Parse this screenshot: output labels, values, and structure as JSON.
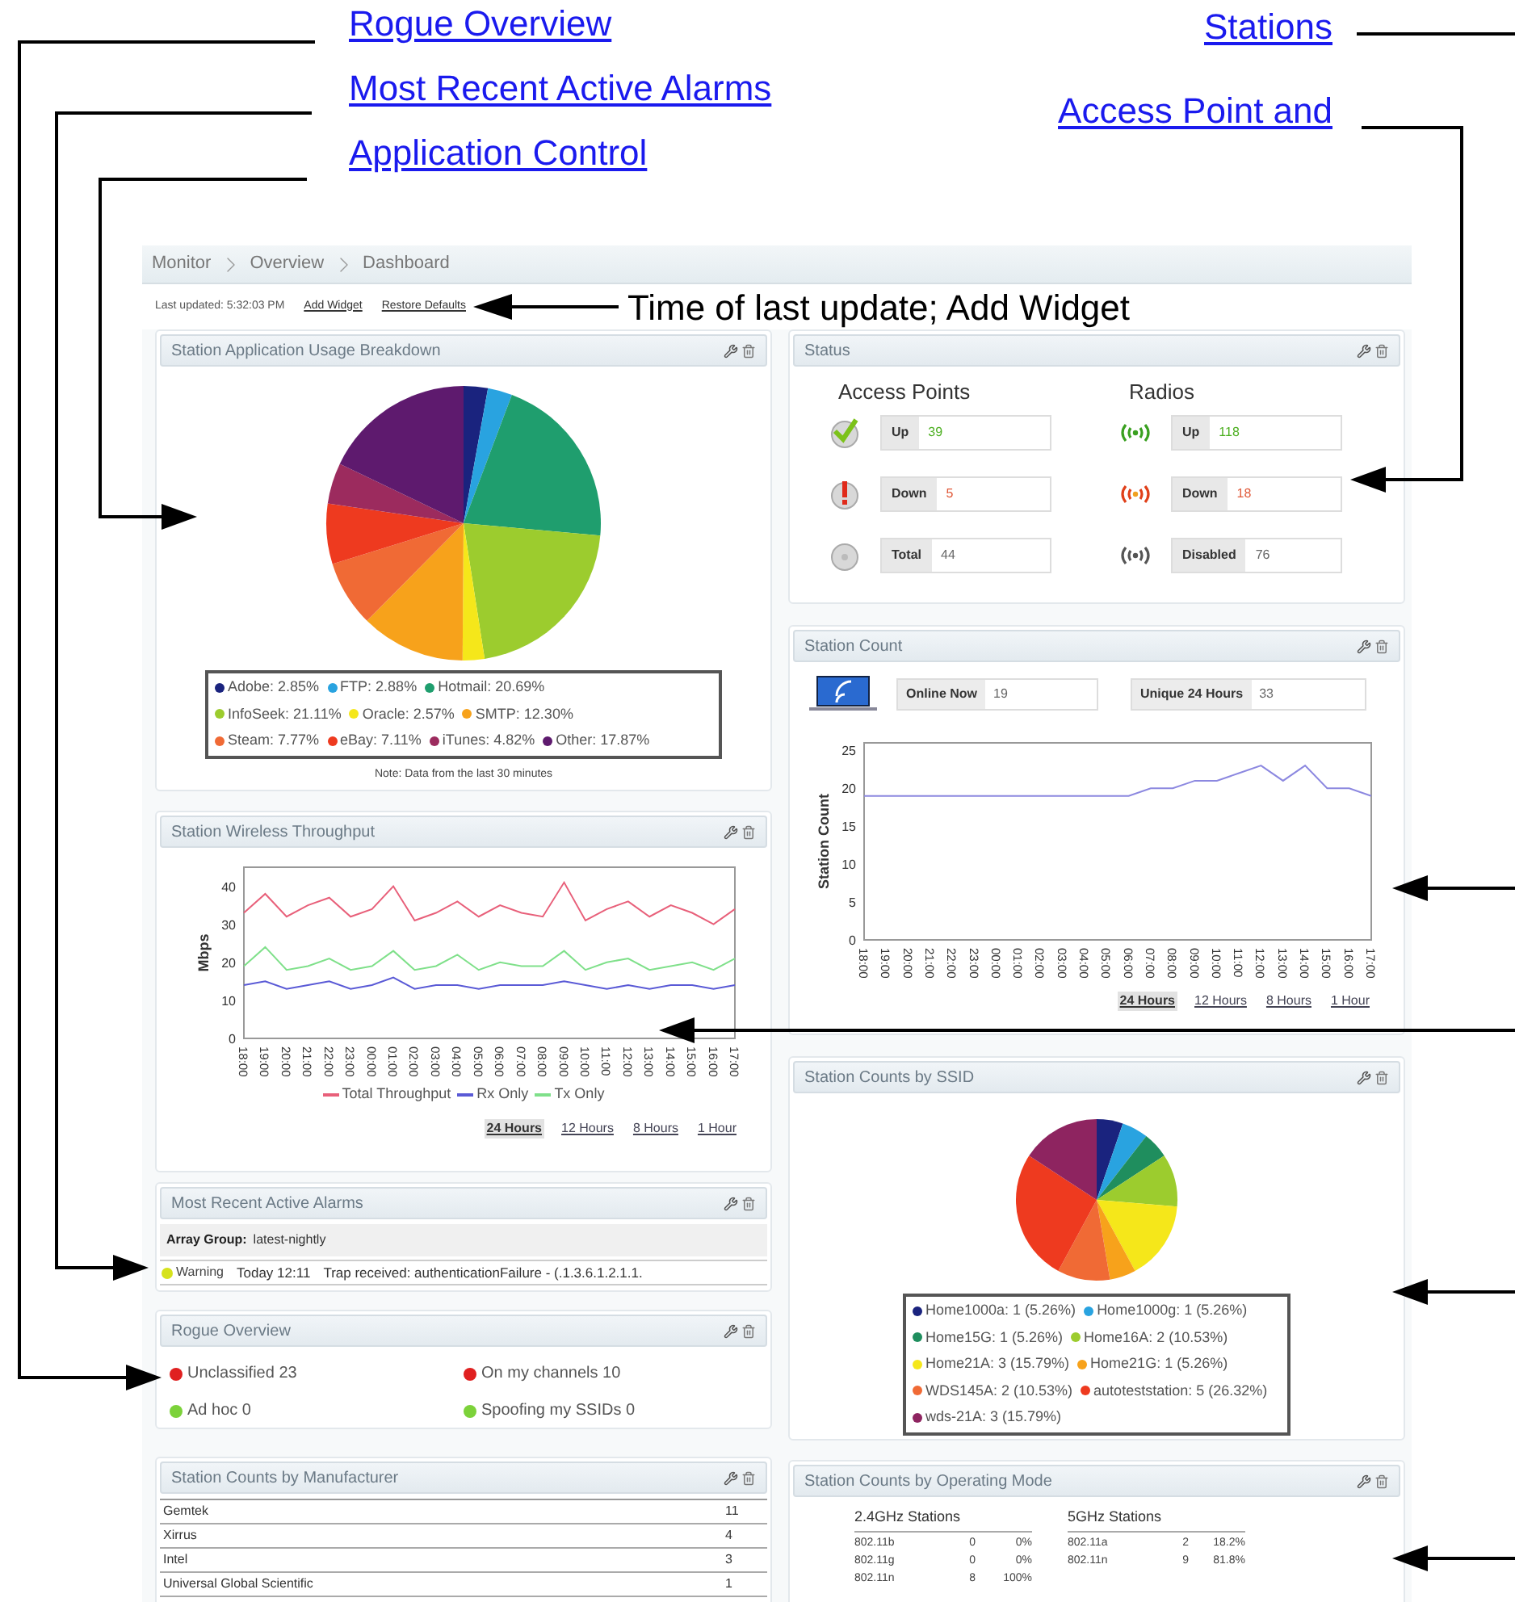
{
  "callout_links_left": [
    "Rogue Overview",
    "Most Recent Active Alarms",
    "Application Control"
  ],
  "callout_links_right": [
    "Stations",
    "Access Point and"
  ],
  "breadcrumb": [
    "Monitor",
    "Overview",
    "Dashboard"
  ],
  "toolbar": {
    "last_updated": "Last updated: 5:32:03 PM",
    "links": [
      "Add Widget",
      "Restore Defaults"
    ],
    "callout_note": "Time of last update; Add Widget"
  },
  "app_usage": {
    "title": "Station Application Usage Breakdown",
    "chart_data": {
      "type": "pie",
      "categories": [
        "Adobe: 2.85%",
        "FTP: 2.88%",
        "Hotmail: 20.69%",
        "InfoSeek: 21.11%",
        "Oracle: 2.57%",
        "SMTP: 12.30%",
        "Steam: 7.77%",
        "eBay: 7.11%",
        "iTunes: 4.82%",
        "Other: 17.87%"
      ],
      "values": [
        2.85,
        2.88,
        20.69,
        21.11,
        2.57,
        12.3,
        7.77,
        7.11,
        4.82,
        17.87
      ]
    },
    "legend": [
      [
        {
          "color": "#1a237e"
        },
        {
          "color": "#29a3e0"
        },
        {
          "color": "#1f9e6e"
        }
      ],
      [
        {
          "color": "#9ccc2e"
        },
        {
          "color": "#f5e71a"
        },
        {
          "color": "#f7a21b"
        }
      ],
      [
        {
          "color": "#f06a35"
        },
        {
          "color": "#ee3a1f"
        },
        {
          "color": "#9c2b5e"
        },
        {
          "color": "#5e1a6e"
        }
      ]
    ],
    "note": "Note: Data from the last 30 minutes"
  },
  "throughput": {
    "title": "Station Wireless Throughput",
    "chart_data": {
      "type": "line",
      "ylabel": "Mbps",
      "categories": [
        "18:00",
        "19:00",
        "20:00",
        "21:00",
        "22:00",
        "23:00",
        "00:00",
        "01:00",
        "02:00",
        "03:00",
        "04:00",
        "05:00",
        "06:00",
        "07:00",
        "08:00",
        "09:00",
        "10:00",
        "11:00",
        "12:00",
        "13:00",
        "14:00",
        "15:00",
        "16:00",
        "17:00"
      ],
      "ylim": [
        0,
        45
      ],
      "yticks": [
        0,
        10,
        20,
        30,
        40
      ],
      "series": [
        {
          "name": "Total Throughput",
          "color": "#e8607a",
          "values": [
            33,
            38,
            32,
            35,
            37,
            32,
            34,
            40,
            31,
            33,
            36,
            32,
            35,
            33,
            32,
            41,
            31,
            34,
            36,
            32,
            35,
            33,
            30,
            34
          ]
        },
        {
          "name": "Rx Only",
          "color": "#5a5ad6",
          "values": [
            14,
            15,
            13,
            14,
            15,
            13,
            14,
            16,
            13,
            14,
            14,
            13,
            14,
            14,
            14,
            15,
            14,
            13,
            14,
            13,
            14,
            14,
            13,
            14
          ]
        },
        {
          "name": "Tx Only",
          "color": "#7fe08a",
          "values": [
            19,
            24,
            18,
            19,
            21,
            18,
            19,
            23,
            18,
            19,
            22,
            18,
            20,
            19,
            19,
            23,
            18,
            20,
            21,
            18,
            19,
            20,
            18,
            21
          ]
        }
      ]
    },
    "ranges": [
      {
        "label": "24 Hours",
        "selected": true
      },
      {
        "label": "12 Hours",
        "selected": false
      },
      {
        "label": "8 Hours",
        "selected": false
      },
      {
        "label": "1 Hour",
        "selected": false
      }
    ]
  },
  "alarms": {
    "title": "Most Recent Active Alarms",
    "group_label": "Array Group:",
    "group_value": "latest-nightly",
    "rows": [
      {
        "severity": "Warning",
        "color": "#d6e21c",
        "time": "Today 12:11",
        "message": "Trap received: authenticationFailure - (.1.3.6.1.2.1.1."
      }
    ]
  },
  "rogue": {
    "title": "Rogue Overview",
    "items": [
      {
        "text": "Unclassified 23",
        "color": "#e02020"
      },
      {
        "text": "On my channels 10",
        "color": "#e02020"
      },
      {
        "text": "Ad hoc 0",
        "color": "#7cd23a"
      },
      {
        "text": "Spoofing my SSIDs 0",
        "color": "#7cd23a"
      }
    ]
  },
  "manufacturers": {
    "title": "Station Counts by Manufacturer",
    "rows": [
      {
        "name": "Gemtek",
        "count": "11"
      },
      {
        "name": "Xirrus",
        "count": "4"
      },
      {
        "name": "Intel",
        "count": "3"
      },
      {
        "name": "Universal Global Scientific",
        "count": "1"
      }
    ]
  },
  "status": {
    "title": "Status",
    "columns": [
      {
        "heading": "Access Points",
        "kind": "ap",
        "items": [
          {
            "kind": "up",
            "label": "Up",
            "value": "39"
          },
          {
            "kind": "down",
            "label": "Down",
            "value": "5"
          },
          {
            "kind": "total",
            "label": "Total",
            "value": "44"
          }
        ]
      },
      {
        "heading": "Radios",
        "kind": "radio",
        "items": [
          {
            "kind": "up",
            "label": "Up",
            "value": "118"
          },
          {
            "kind": "down",
            "label": "Down",
            "value": "18"
          },
          {
            "kind": "total",
            "label": "Disabled",
            "value": "76"
          }
        ]
      }
    ]
  },
  "station_count": {
    "title": "Station Count",
    "counters": [
      {
        "label": "Online Now",
        "value": "19"
      },
      {
        "label": "Unique 24 Hours",
        "value": "33"
      }
    ],
    "chart_data": {
      "type": "line",
      "ylabel": "Station Count",
      "categories": [
        "18:00",
        "19:00",
        "20:00",
        "21:00",
        "22:00",
        "23:00",
        "00:00",
        "01:00",
        "02:00",
        "03:00",
        "04:00",
        "05:00",
        "06:00",
        "07:00",
        "08:00",
        "09:00",
        "10:00",
        "11:00",
        "12:00",
        "13:00",
        "14:00",
        "15:00",
        "16:00",
        "17:00"
      ],
      "ylim": [
        0,
        26
      ],
      "yticks": [
        0,
        5,
        10,
        15,
        20,
        25
      ],
      "values": [
        19,
        19,
        19,
        19,
        19,
        19,
        19,
        19,
        19,
        19,
        19,
        19,
        19,
        20,
        20,
        21,
        21,
        22,
        23,
        21,
        23,
        20,
        20,
        19
      ]
    },
    "ranges": [
      {
        "label": "24 Hours",
        "selected": true
      },
      {
        "label": "12 Hours",
        "selected": false
      },
      {
        "label": "8 Hours",
        "selected": false
      },
      {
        "label": "1 Hour",
        "selected": false
      }
    ]
  },
  "ssid": {
    "title": "Station Counts by SSID",
    "chart_data": {
      "type": "pie",
      "categories": [
        "Home1000a: 1 (5.26%)",
        "Home1000g: 1 (5.26%)",
        "Home15G: 1 (5.26%)",
        "Home16A: 2 (10.53%)",
        "Home21A: 3 (15.79%)",
        "Home21G: 1 (5.26%)",
        "WDS145A: 2 (10.53%)",
        "autoteststation: 5 (26.32%)",
        "wds-21A: 3 (15.79%)"
      ],
      "values": [
        5.26,
        5.26,
        5.26,
        10.53,
        15.79,
        5.26,
        10.53,
        26.32,
        15.79
      ]
    },
    "legend": [
      [
        {
          "color": "#1a237e"
        },
        {
          "color": "#29a3e0"
        }
      ],
      [
        {
          "color": "#1f8e5e"
        },
        {
          "color": "#9ccc2e"
        }
      ],
      [
        {
          "color": "#f5e71a"
        },
        {
          "color": "#f7a21b"
        }
      ],
      [
        {
          "color": "#f06a35"
        },
        {
          "color": "#ee3a1f"
        }
      ],
      [
        {
          "color": "#8e2460"
        }
      ]
    ]
  },
  "operating_mode": {
    "title": "Station Counts by Operating Mode",
    "groups": [
      {
        "title": "2.4GHz Stations",
        "rows": [
          {
            "mode": "802.11b",
            "count": "0",
            "percent": "0%"
          },
          {
            "mode": "802.11g",
            "count": "0",
            "percent": "0%"
          },
          {
            "mode": "802.11n",
            "count": "8",
            "percent": "100%"
          }
        ]
      },
      {
        "title": "5GHz Stations",
        "rows": [
          {
            "mode": "802.11a",
            "count": "2",
            "percent": "18.2%"
          },
          {
            "mode": "802.11n",
            "count": "9",
            "percent": "81.8%"
          }
        ]
      }
    ]
  }
}
